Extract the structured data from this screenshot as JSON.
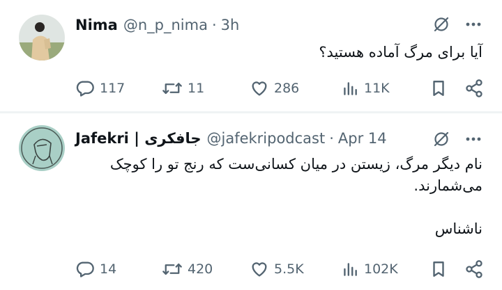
{
  "tweets": [
    {
      "author_name": "Nima",
      "handle": "@n_p_nima",
      "separator": "·",
      "time": "3h",
      "text_lines": [
        "آیا برای مرگ آماده هستید؟"
      ],
      "stats": {
        "replies": "117",
        "retweets": "11",
        "likes": "286",
        "views": "11K"
      }
    },
    {
      "author_name": "Jafekri | جافکری",
      "handle": "@jafekripodcast",
      "separator": "·",
      "time": "Apr 14",
      "text_lines": [
        "نام دیگر مرگ، زیستن در میان کسانی‌ست که رنج تو را کوچک",
        "می‌شمارند."
      ],
      "signature": "ناشناس",
      "stats": {
        "replies": "14",
        "retweets": "420",
        "likes": "5.5K",
        "views": "102K"
      }
    }
  ],
  "icons": {
    "reply": "reply-icon",
    "retweet": "retweet-icon",
    "like": "heart-icon",
    "views": "views-icon",
    "bookmark": "bookmark-icon",
    "share": "share-icon",
    "grok": "grok-icon",
    "more": "more-icon"
  },
  "colors": {
    "text": "#0f1419",
    "secondary": "#536471",
    "divider": "#eff3f4",
    "avatar2_bg": "#a9cfc6"
  }
}
